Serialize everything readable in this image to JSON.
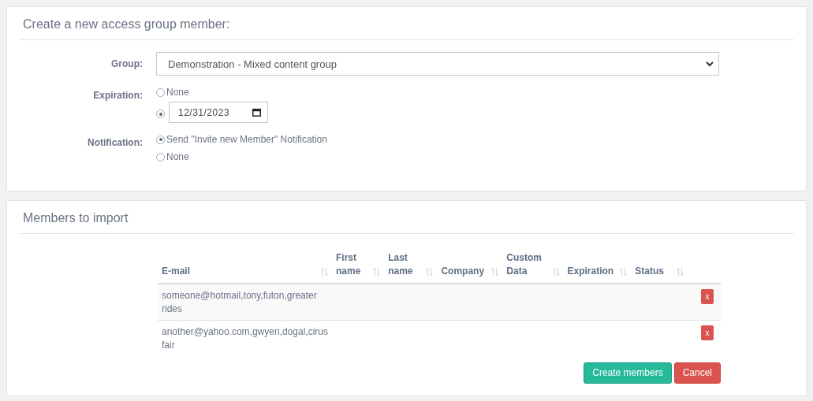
{
  "create_panel": {
    "title": "Create a new access group member:",
    "group": {
      "label": "Group:",
      "value": "Demonstration - Mixed content group"
    },
    "expiration": {
      "label": "Expiration:",
      "options": [
        {
          "kind": "text",
          "label": "None",
          "selected": false
        },
        {
          "kind": "date",
          "value": "12/31/2023",
          "selected": true
        }
      ]
    },
    "notification": {
      "label": "Notification:",
      "options": [
        {
          "kind": "text",
          "label": "Send \"Invite new Member\" Notification",
          "selected": true
        },
        {
          "kind": "text",
          "label": "None",
          "selected": false
        }
      ]
    }
  },
  "import_panel": {
    "title": "Members to import",
    "table": {
      "columns": [
        [
          "E-mail"
        ],
        [
          "First",
          "name"
        ],
        [
          "Last",
          "name"
        ],
        [
          "Company"
        ],
        [
          "Custom",
          "Data"
        ],
        [
          "Expiration"
        ],
        [
          "Status"
        ]
      ],
      "rows": [
        {
          "email": [
            "someone@hotmail,tony,futon,greater",
            "rides"
          ],
          "delete_label": "x"
        },
        {
          "email": [
            "another@yahoo.com,gwyen,dogal,cirus",
            "fair"
          ],
          "delete_label": "x"
        }
      ]
    },
    "buttons": [
      {
        "kind": "primary",
        "label": "Create members"
      },
      {
        "kind": "danger",
        "label": "Cancel"
      }
    ]
  }
}
